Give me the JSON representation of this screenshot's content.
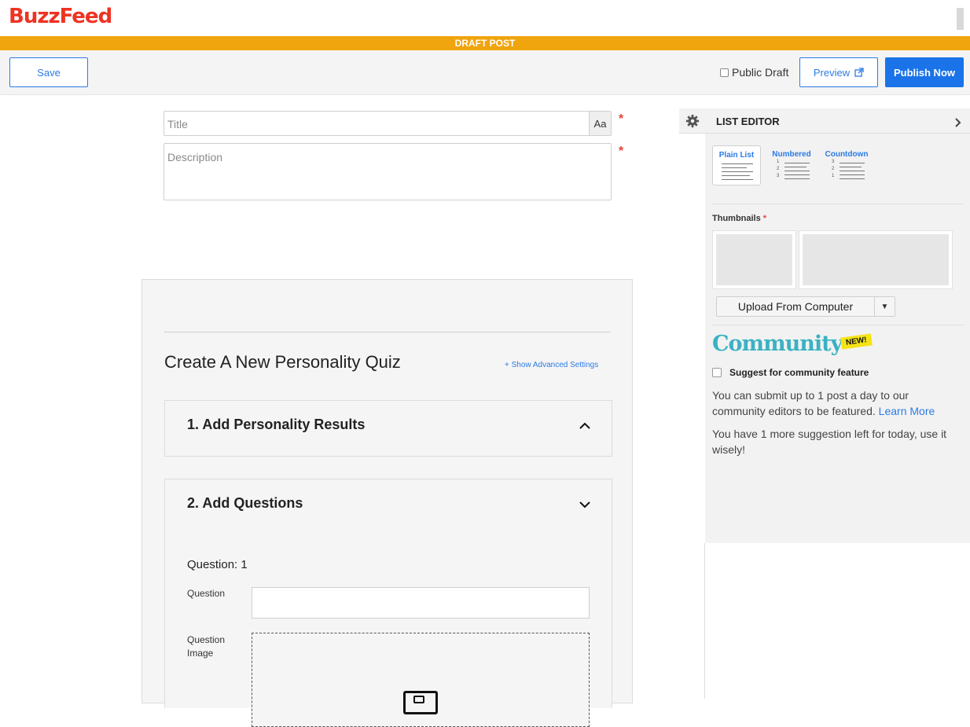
{
  "header": {
    "logo_text": "BuzzFeed",
    "status_banner": "DRAFT POST"
  },
  "toolbar": {
    "save_label": "Save",
    "public_draft_label": "Public Draft",
    "public_draft_checked": false,
    "preview_label": "Preview",
    "publish_label": "Publish Now"
  },
  "post": {
    "title_placeholder": "Title",
    "title_format_label": "Aa",
    "description_placeholder": "Description",
    "required_mark": "*"
  },
  "quiz": {
    "heading": "Create A New Personality Quiz",
    "advanced_link": "+ Show Advanced Settings",
    "sections": [
      {
        "label": "1. Add Personality Results",
        "expanded": true
      },
      {
        "label": "2. Add Questions",
        "expanded": false
      }
    ],
    "question": {
      "number_label": "Question: 1",
      "question_label": "Question",
      "image_label": "Question Image"
    }
  },
  "sidebar": {
    "title": "LIST EDITOR",
    "list_types": [
      {
        "label": "Plain List",
        "active": true
      },
      {
        "label": "Numbered",
        "active": false
      },
      {
        "label": "Countdown",
        "active": false
      }
    ],
    "numbered_marks": [
      "1",
      "2",
      "3"
    ],
    "thumbnails_label": "Thumbnails",
    "upload_label": "Upload From Computer",
    "community_heading": "Community",
    "new_badge": "NEW!",
    "suggest_label": "Suggest for community feature",
    "submit_text": "You can submit up to 1 post a day to our community editors to be featured.",
    "learn_more": "Learn More",
    "remaining_text": "You have 1 more suggestion left for today, use it wisely!"
  },
  "colors": {
    "brand_red": "#ee3322",
    "draft_orange": "#f0a40e",
    "accent_blue": "#1a73e8",
    "community_teal": "#3bb2c3"
  }
}
